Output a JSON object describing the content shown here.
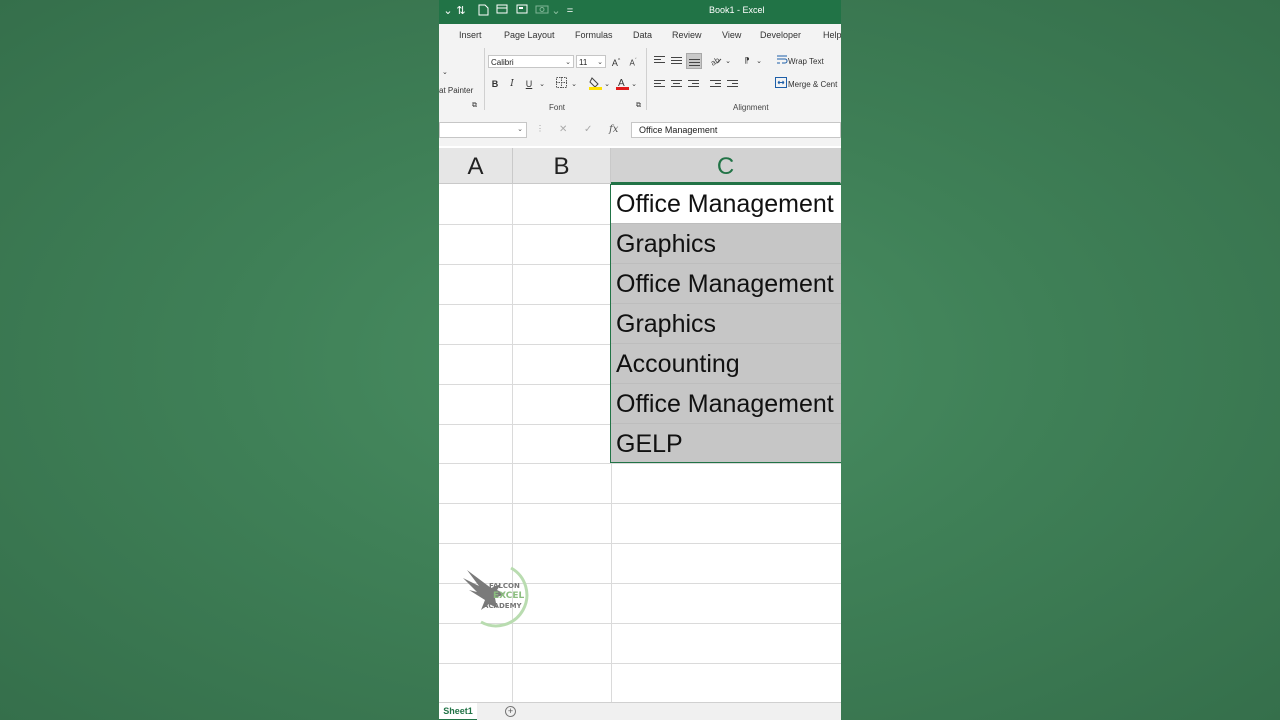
{
  "window": {
    "title": "Book1  -  Excel"
  },
  "tabs": [
    "Insert",
    "Page Layout",
    "Formulas",
    "Data",
    "Review",
    "View",
    "Developer",
    "Help"
  ],
  "ribbon": {
    "clipboard": {
      "format_painter_label": "at Painter"
    },
    "font": {
      "group_label": "Font",
      "font_name": "Calibri",
      "font_size": "11",
      "bold": "B",
      "italic": "I",
      "underline": "U",
      "font_color": "#e01b1b",
      "highlight_color": "#ffe100"
    },
    "alignment": {
      "group_label": "Alignment",
      "wrap_text_label": "Wrap Text",
      "merge_label": "Merge & Cent"
    }
  },
  "formula_bar": {
    "name_box": "",
    "fx": "fx",
    "value": "Office Management"
  },
  "columns": [
    "A",
    "B",
    "C"
  ],
  "selected_column": "C",
  "column_c_cells": [
    "Office Management",
    "Graphics",
    "Office Management",
    "Graphics",
    "Accounting",
    "Office Management",
    "GELP"
  ],
  "logo": {
    "line1": "FALCON",
    "line2": "EXCEL",
    "line3": "ACADEMY"
  },
  "sheets": [
    {
      "name": "Sheet1",
      "active": true
    }
  ],
  "colors": {
    "accent": "#217346",
    "selection_fill": "#c6c6c6"
  }
}
